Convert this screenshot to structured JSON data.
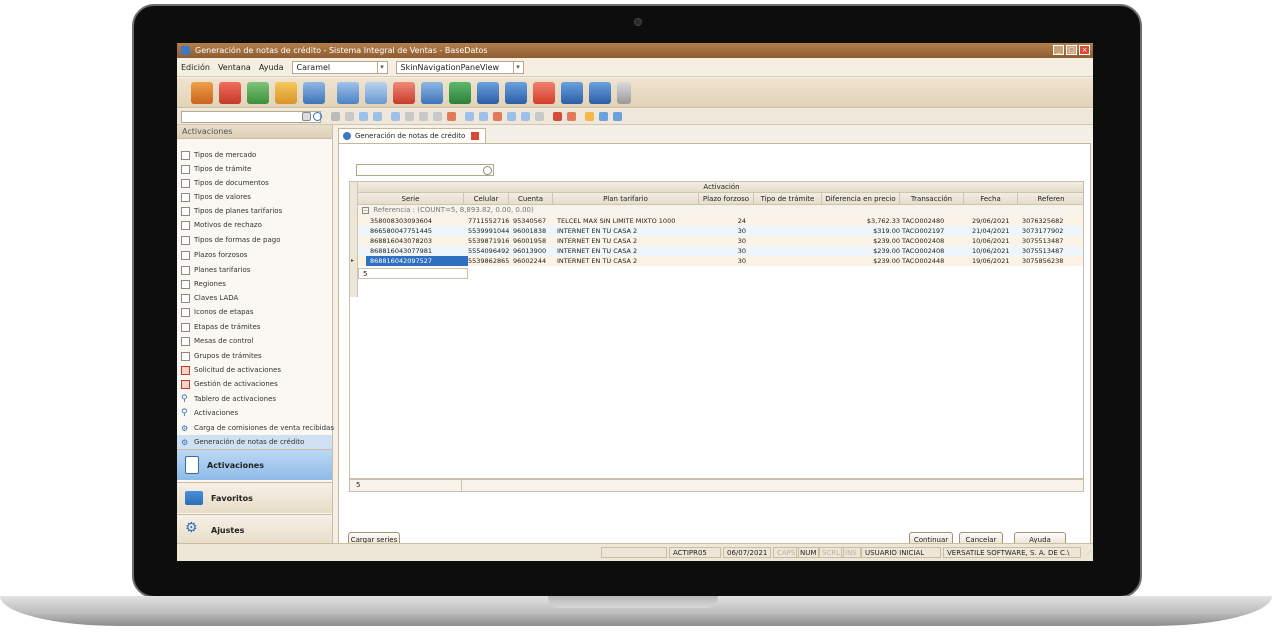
{
  "window": {
    "title": "Generación de notas de crédito - Sistema Integral de Ventas - BaseDatos"
  },
  "menu": {
    "items": [
      "Edición",
      "Ventana",
      "Ayuda"
    ],
    "skin_value": "Caramel",
    "pane_value": "SkinNavigationPaneView"
  },
  "sidebar": {
    "header": "Activaciones",
    "items": [
      {
        "label": "Tipos de mercado",
        "icon": "grid-icon"
      },
      {
        "label": "Tipos de trámite",
        "icon": "grid-icon"
      },
      {
        "label": "Tipos de documentos",
        "icon": "grid-icon"
      },
      {
        "label": "Tipos de valores",
        "icon": "grid-icon"
      },
      {
        "label": "Tipos de planes tarifarios",
        "icon": "grid-icon"
      },
      {
        "label": "Motivos de rechazo",
        "icon": "grid-icon"
      },
      {
        "label": "Tipos de formas de pago",
        "icon": "grid-icon"
      },
      {
        "label": "Plazos forzosos",
        "icon": "grid-icon"
      },
      {
        "label": "Planes tarifarios",
        "icon": "grid-icon"
      },
      {
        "label": "Regiones",
        "icon": "grid-icon"
      },
      {
        "label": "Claves LADA",
        "icon": "grid-icon"
      },
      {
        "label": "Iconos de etapas",
        "icon": "grid-icon"
      },
      {
        "label": "Etapas de trámites",
        "icon": "grid-icon"
      },
      {
        "label": "Mesas de control",
        "icon": "grid-icon"
      },
      {
        "label": "Grupos de trámites",
        "icon": "grid-icon"
      },
      {
        "label": "Solicitud de activaciones",
        "icon": "document-add-icon"
      },
      {
        "label": "Gestión de activaciones",
        "icon": "document-add-icon"
      },
      {
        "label": "Tablero de activaciones",
        "icon": "search-icon"
      },
      {
        "label": "Activaciones",
        "icon": "search-icon"
      },
      {
        "label": "Carga de comisiones de venta recibidas",
        "icon": "gears-icon"
      },
      {
        "label": "Generación de notas de crédito",
        "icon": "gears-icon"
      }
    ],
    "nav_buttons": [
      {
        "label": "Activaciones",
        "icon": "device-icon"
      },
      {
        "label": "Favoritos",
        "icon": "favorites-icon"
      },
      {
        "label": "Ajustes",
        "icon": "gears-icon"
      }
    ]
  },
  "tab": {
    "label": "Generación de notas de crédito"
  },
  "grid": {
    "band_title": "Activación",
    "columns": [
      "Serie",
      "Celular",
      "Cuenta",
      "Plan tarifario",
      "Plazo forzoso",
      "Tipo de trámite",
      "Diferencia en precio",
      "Transacción",
      "Fecha",
      "Referen"
    ],
    "group_row": "Referencia : (COUNT=5, 8,893.82, 0.00, 0.00)",
    "rows": [
      {
        "serie": "358008303093604",
        "celular": "7711552716",
        "cuenta": "95340567",
        "plan": "TELCEL MAX SIN LIMITE MIXTO 1000",
        "plazo": "24",
        "tipo": "",
        "diferencia": "$3,762.33",
        "transaccion": "TACO002480",
        "fecha": "29/06/2021",
        "referencia": "3076325682"
      },
      {
        "serie": "866580047751445",
        "celular": "5539991044",
        "cuenta": "96001838",
        "plan": "INTERNET EN TU CASA 2",
        "plazo": "30",
        "tipo": "",
        "diferencia": "$319.00",
        "transaccion": "TACO002197",
        "fecha": "21/04/2021",
        "referencia": "3073177902"
      },
      {
        "serie": "868816043078203",
        "celular": "5539871916",
        "cuenta": "96001958",
        "plan": "INTERNET EN TU CASA 2",
        "plazo": "30",
        "tipo": "",
        "diferencia": "$239.00",
        "transaccion": "TACO002408",
        "fecha": "10/06/2021",
        "referencia": "3075513487"
      },
      {
        "serie": "868816043077981",
        "celular": "5554096492",
        "cuenta": "96013900",
        "plan": "INTERNET EN TU CASA 2",
        "plazo": "30",
        "tipo": "",
        "diferencia": "$239.00",
        "transaccion": "TACO002408",
        "fecha": "10/06/2021",
        "referencia": "3075513487"
      },
      {
        "serie": "868816042097527",
        "celular": "5539862865",
        "cuenta": "96002244",
        "plan": "INTERNET EN TU CASA 2",
        "plazo": "30",
        "tipo": "",
        "diferencia": "$239.00",
        "transaccion": "TACO002448",
        "fecha": "19/06/2021",
        "referencia": "3075856238"
      }
    ],
    "group_count": "5",
    "footer_count": "5"
  },
  "buttons": {
    "cargar": "Cargar series",
    "continuar": "Continuar",
    "cancelar": "Cancelar",
    "ayuda": "Ayuda"
  },
  "status": {
    "program": "ACTIPR05",
    "date": "06/07/2021",
    "caps": "CAPS",
    "num": "NUM",
    "scrl": "SCRL",
    "ins": "INS",
    "user": "USUARIO INICIAL",
    "company": "VERSATILE SOFTWARE, S. A. DE C.\\"
  },
  "colors": {
    "accent": "#2f6fbf",
    "titlebar": "#9b6a3c",
    "selection": "#8fbbe8"
  }
}
